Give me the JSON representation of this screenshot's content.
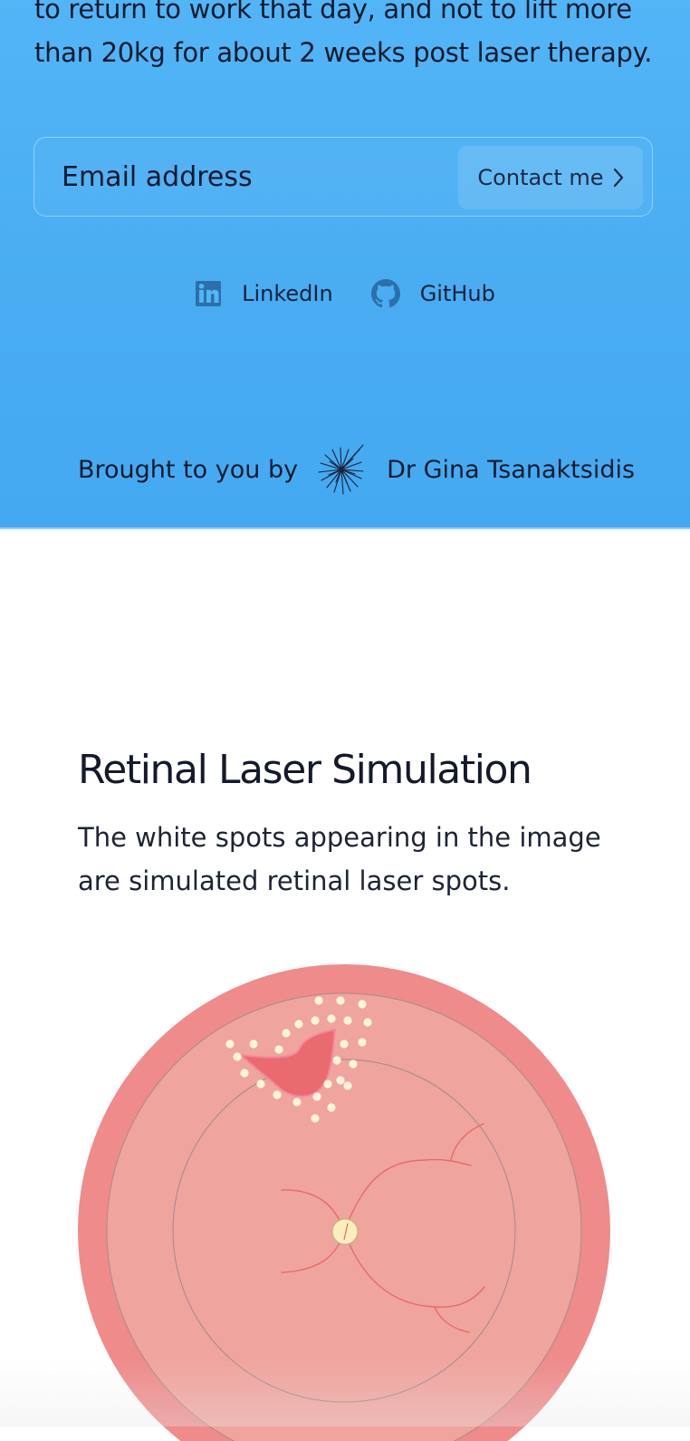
{
  "intro": {
    "line1": "to return to work that day, and not to lift more",
    "line2": "than 20kg for about 2 weeks post laser therapy."
  },
  "contact": {
    "email_placeholder": "Email address",
    "button_label": "Contact me"
  },
  "socials": [
    {
      "label": "LinkedIn",
      "icon": "linkedin-icon"
    },
    {
      "label": "GitHub",
      "icon": "github-icon"
    }
  ],
  "credit": {
    "prefix": "Brought to you by",
    "author": "Dr Gina Tsanaktsidis"
  },
  "simulation": {
    "title": "Retinal Laser Simulation",
    "description": "The white spots appearing in the image are simulated retinal laser spots.",
    "laser_spot_count": 32
  },
  "colors": {
    "banner_blue": "#4aaef3",
    "retina_outer": "#ef8b8b",
    "retina_inner": "#f0a49e",
    "lesion": "#ea6b6f",
    "laser_spot": "#fdf5dc",
    "optic_disc": "#f8eebe",
    "vessels": "#e86a66"
  }
}
